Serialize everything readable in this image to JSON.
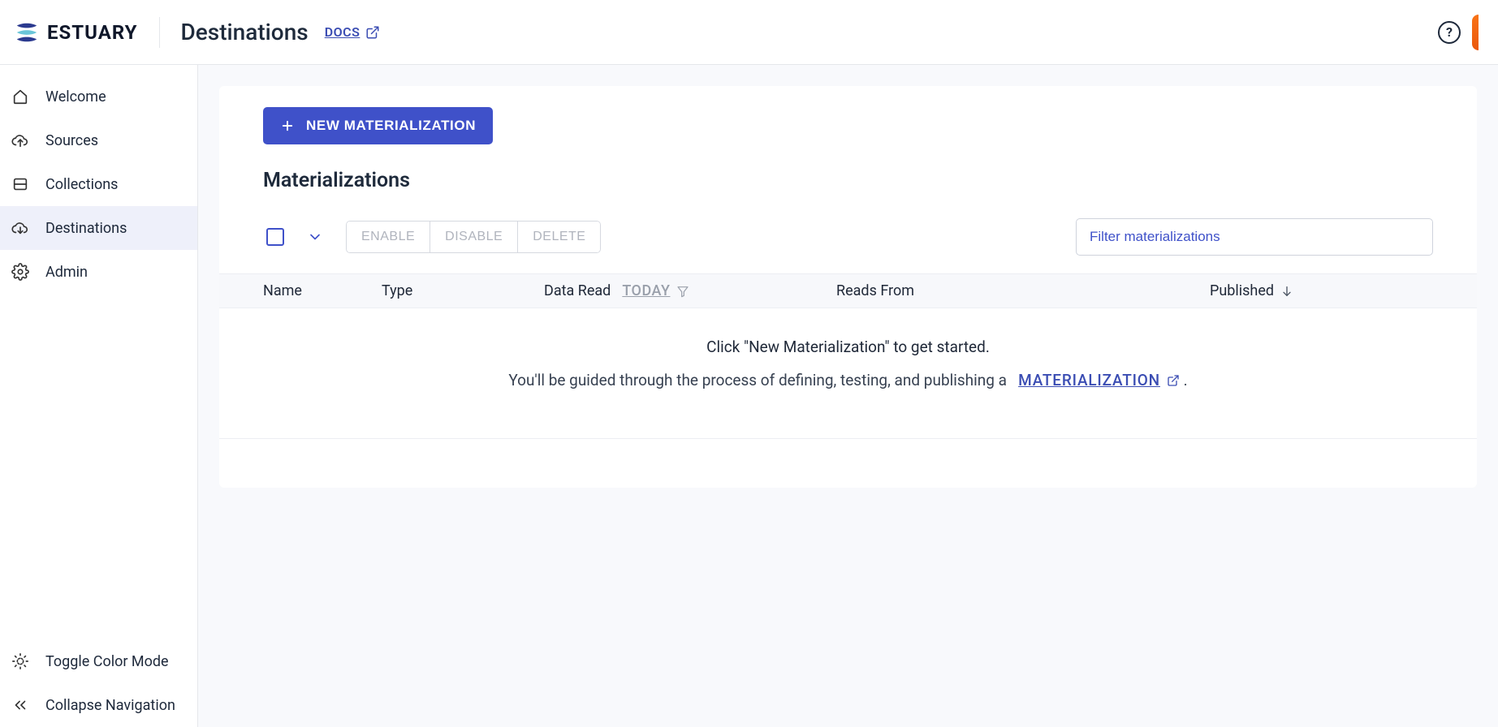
{
  "brand": "ESTUARY",
  "header": {
    "title": "Destinations",
    "docs_label": "DOCS"
  },
  "sidebar": {
    "items": [
      {
        "label": "Welcome"
      },
      {
        "label": "Sources"
      },
      {
        "label": "Collections"
      },
      {
        "label": "Destinations"
      },
      {
        "label": "Admin"
      }
    ],
    "toggle_color": "Toggle Color Mode",
    "collapse_nav": "Collapse Navigation"
  },
  "main": {
    "new_button": "NEW MATERIALIZATION",
    "section_title": "Materializations",
    "toolbar": {
      "enable": "ENABLE",
      "disable": "DISABLE",
      "delete": "DELETE",
      "filter_placeholder": "Filter materializations"
    },
    "columns": {
      "name": "Name",
      "type": "Type",
      "data_read": "Data Read",
      "data_read_range": "TODAY",
      "reads_from": "Reads From",
      "published": "Published"
    },
    "empty": {
      "line1": "Click \"New Materialization\" to get started.",
      "line2a": "You'll be guided through the process of defining, testing, and publishing a",
      "link": "MATERIALIZATION",
      "line2b": "."
    }
  }
}
